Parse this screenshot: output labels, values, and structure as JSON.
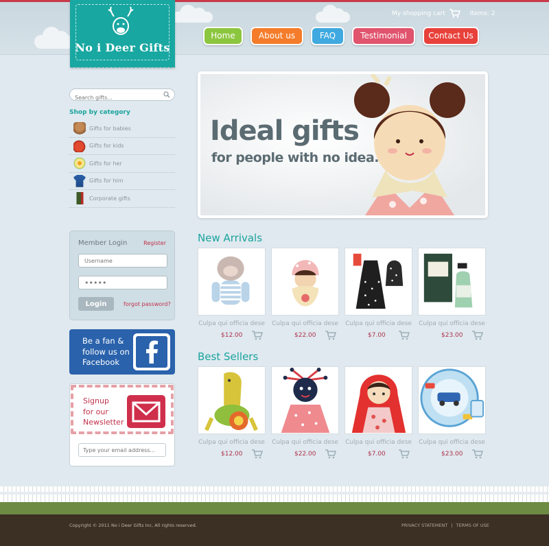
{
  "header": {
    "logo_text": "No i Deer Gifts",
    "cart_label": "My shopping cart",
    "items_label": "Items: 2",
    "nav": [
      {
        "label": "Home",
        "color": "#8cc63f"
      },
      {
        "label": "About us",
        "color": "#f47c2a"
      },
      {
        "label": "FAQ",
        "color": "#3fa9e0"
      },
      {
        "label": "Testimonial",
        "color": "#e0546e"
      },
      {
        "label": "Contact Us",
        "color": "#e8413b"
      }
    ]
  },
  "sidebar": {
    "search_placeholder": "Search gifts...",
    "category_title": "Shop by category",
    "categories": [
      {
        "label": "Gifts for babies",
        "icon": "teddy-bear-icon",
        "color": "#b07a4a"
      },
      {
        "label": "Gifts for kids",
        "icon": "apple-icon",
        "color": "#d63b2a"
      },
      {
        "label": "Gifts for her",
        "icon": "flower-icon",
        "color": "#e9c234"
      },
      {
        "label": "Gifts for him",
        "icon": "shirt-icon",
        "color": "#2b5fa8"
      },
      {
        "label": "Corporate gifts",
        "icon": "wine-bottle-icon",
        "color": "#4c6a2f"
      }
    ],
    "login": {
      "title": "Member Login",
      "register": "Register",
      "username_placeholder": "Username",
      "password_value": "•••••",
      "button": "Login",
      "forgot": "forgot password?"
    },
    "facebook": {
      "line1": "Be a fan &",
      "line2": "follow us on",
      "line3": "Facebook"
    },
    "newsletter": {
      "line1": "Signup",
      "line2": "for our",
      "line3": "Newsletter",
      "email_placeholder": "Type your email address..."
    }
  },
  "banner": {
    "headline": "Ideal gifts",
    "subline": "for people with no idea..."
  },
  "new_arrivals": {
    "title": "New Arrivals",
    "products": [
      {
        "name": "Culpa qui officia dese",
        "price": "$12.00",
        "kind": "monkey"
      },
      {
        "name": "Culpa qui officia dese",
        "price": "$22.00",
        "kind": "doll"
      },
      {
        "name": "Culpa qui officia dese",
        "price": "$7.00",
        "kind": "apron"
      },
      {
        "name": "Culpa qui officia dese",
        "price": "$23.00",
        "kind": "soap"
      }
    ]
  },
  "best_sellers": {
    "title": "Best Sellers",
    "products": [
      {
        "name": "Culpa qui officia dese",
        "price": "$12.00",
        "kind": "giraffe"
      },
      {
        "name": "Culpa qui officia dese",
        "price": "$22.00",
        "kind": "raggedy"
      },
      {
        "name": "Culpa qui officia dese",
        "price": "$7.00",
        "kind": "redhood"
      },
      {
        "name": "Culpa qui officia dese",
        "price": "$23.00",
        "kind": "plates"
      }
    ]
  },
  "footer": {
    "copyright": "Copyright © 2011 No i Deer Gifts Inc, All rights reserved.",
    "privacy": "PRIVACY STATEMENT",
    "separator": "|",
    "terms": "TERMS OF USE"
  }
}
